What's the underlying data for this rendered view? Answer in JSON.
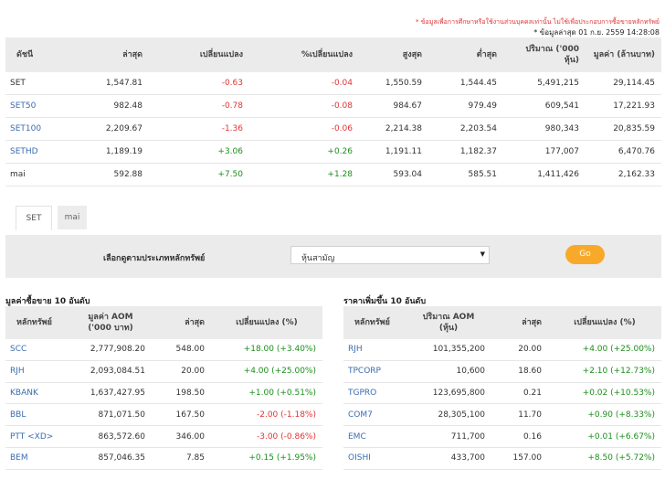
{
  "notes": {
    "disclaimer": "* ข้อมูลเพื่อการศึกษาหรือใช้งานส่วนบุคคลเท่านั้น ไม่ใช้เพื่อประกอบการซื้อขายหลักทรัพย์",
    "updated": "* ข้อมูลล่าสุด 01 ก.ย. 2559 14:28:08"
  },
  "index_table": {
    "headers": [
      "ดัชนี",
      "ล่าสุด",
      "เปลี่ยนแปลง",
      "%เปลี่ยนแปลง",
      "สูงสุด",
      "ต่ำสุด",
      "ปริมาณ ('000 หุ้น)",
      "มูลค่า (ล้านบาท)"
    ],
    "rows": [
      {
        "name": "SET",
        "last": "1,547.81",
        "change": "-0.63",
        "pct": "-0.04",
        "high": "1,550.59",
        "low": "1,544.45",
        "volume": "5,491,215",
        "value": "29,114.45",
        "link": false,
        "dir": "neg"
      },
      {
        "name": "SET50",
        "last": "982.48",
        "change": "-0.78",
        "pct": "-0.08",
        "high": "984.67",
        "low": "979.49",
        "volume": "609,541",
        "value": "17,221.93",
        "link": true,
        "dir": "neg"
      },
      {
        "name": "SET100",
        "last": "2,209.67",
        "change": "-1.36",
        "pct": "-0.06",
        "high": "2,214.38",
        "low": "2,203.54",
        "volume": "980,343",
        "value": "20,835.59",
        "link": true,
        "dir": "neg"
      },
      {
        "name": "SETHD",
        "last": "1,189.19",
        "change": "+3.06",
        "pct": "+0.26",
        "high": "1,191.11",
        "low": "1,182.37",
        "volume": "177,007",
        "value": "6,470.76",
        "link": true,
        "dir": "pos"
      },
      {
        "name": "mai",
        "last": "592.88",
        "change": "+7.50",
        "pct": "+1.28",
        "high": "593.04",
        "low": "585.51",
        "volume": "1,411,426",
        "value": "2,162.33",
        "link": false,
        "dir": "pos"
      }
    ]
  },
  "tabs": {
    "set": "SET",
    "mai": "mai"
  },
  "filter": {
    "label": "เลือกดูตามประเภทหลักทรัพย์",
    "selected": "หุ้นสามัญ",
    "go": "Go"
  },
  "top_value": {
    "title": "มูลค่าซื้อขาย 10 อันดับ",
    "headers": [
      "หลักทรัพย์",
      "มูลค่า AOM ('000 บาท)",
      "ล่าสุด",
      "เปลี่ยนแปลง (%)"
    ],
    "rows": [
      {
        "symbol": "SCC",
        "amount": "2,777,908.20",
        "last": "548.00",
        "change": "+18.00 (+3.40%)",
        "dir": "pos"
      },
      {
        "symbol": "RJH",
        "amount": "2,093,084.51",
        "last": "20.00",
        "change": "+4.00 (+25.00%)",
        "dir": "pos"
      },
      {
        "symbol": "KBANK",
        "amount": "1,637,427.95",
        "last": "198.50",
        "change": "+1.00 (+0.51%)",
        "dir": "pos"
      },
      {
        "symbol": "BBL",
        "amount": "871,071.50",
        "last": "167.50",
        "change": "-2.00 (-1.18%)",
        "dir": "neg"
      },
      {
        "symbol": "PTT <XD>",
        "amount": "863,572.60",
        "last": "346.00",
        "change": "-3.00 (-0.86%)",
        "dir": "neg"
      },
      {
        "symbol": "BEM",
        "amount": "857,046.35",
        "last": "7.85",
        "change": "+0.15 (+1.95%)",
        "dir": "pos"
      }
    ]
  },
  "top_gainers": {
    "title": "ราคาเพิ่มขึ้น 10 อันดับ",
    "headers": [
      "หลักทรัพย์",
      "ปริมาณ AOM (หุ้น)",
      "ล่าสุด",
      "เปลี่ยนแปลง (%)"
    ],
    "rows": [
      {
        "symbol": "RJH",
        "amount": "101,355,200",
        "last": "20.00",
        "change": "+4.00 (+25.00%)",
        "dir": "pos"
      },
      {
        "symbol": "TPCORP",
        "amount": "10,600",
        "last": "18.60",
        "change": "+2.10 (+12.73%)",
        "dir": "pos"
      },
      {
        "symbol": "TGPRO",
        "amount": "123,695,800",
        "last": "0.21",
        "change": "+0.02 (+10.53%)",
        "dir": "pos"
      },
      {
        "symbol": "COM7",
        "amount": "28,305,100",
        "last": "11.70",
        "change": "+0.90 (+8.33%)",
        "dir": "pos"
      },
      {
        "symbol": "EMC",
        "amount": "711,700",
        "last": "0.16",
        "change": "+0.01 (+6.67%)",
        "dir": "pos"
      },
      {
        "symbol": "OISHI",
        "amount": "433,700",
        "last": "157.00",
        "change": "+8.50 (+5.72%)",
        "dir": "pos"
      }
    ]
  },
  "colors": {
    "negative": "#e03434",
    "positive": "#1a8f1a",
    "link": "#3a6cb0",
    "go_button": "#f9a92a",
    "header_bg": "#ebebeb"
  }
}
